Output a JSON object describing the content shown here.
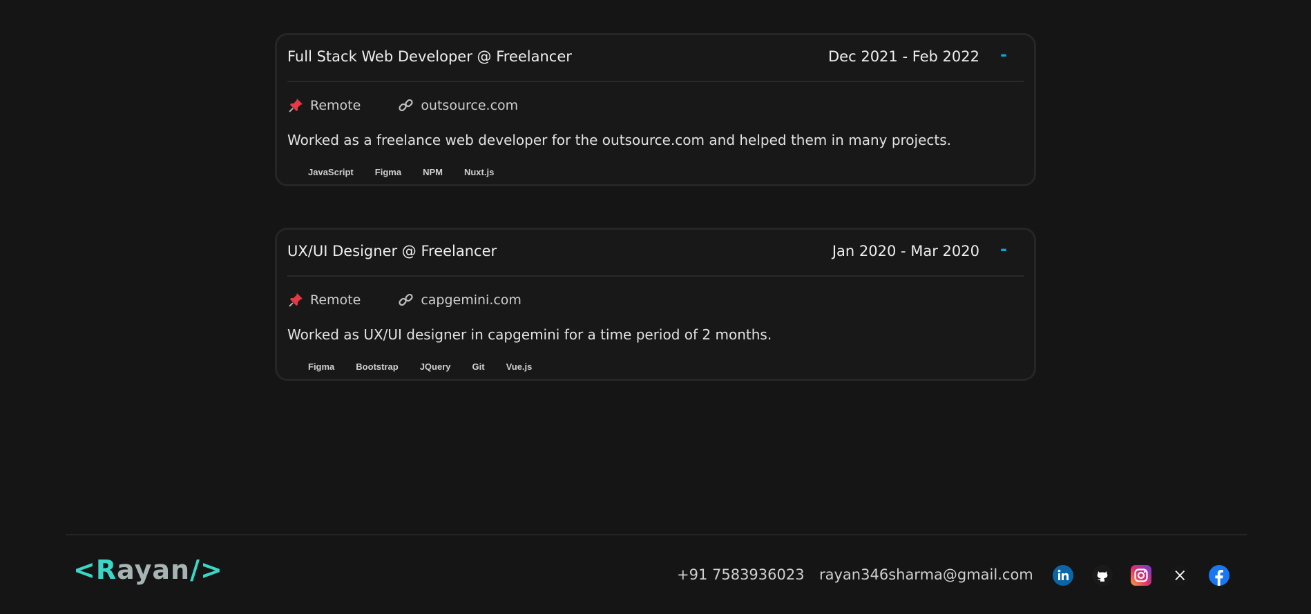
{
  "experiences": [
    {
      "title": "Full Stack Web Developer @ Freelancer",
      "date": "Dec 2021 - Feb 2022",
      "toggle": "-",
      "location": "Remote",
      "website": "outsource.com",
      "description": "Worked as a freelance web developer for the outsource.com and helped them in many projects.",
      "tags": [
        "JavaScript",
        "Figma",
        "NPM",
        "Nuxt.js"
      ]
    },
    {
      "title": "UX/UI Designer @ Freelancer",
      "date": "Jan 2020 - Mar 2020",
      "toggle": "-",
      "location": "Remote",
      "website": "capgemini.com",
      "description": "Worked as UX/UI designer in capgemini for a time period of 2 months.",
      "tags": [
        "Figma",
        "Bootstrap",
        "JQuery",
        "Git",
        "Vue.js"
      ]
    }
  ],
  "footer": {
    "logo_open": "<",
    "logo_first": "R",
    "logo_rest": "ayan",
    "logo_close": "/>",
    "phone": "+91 7583936023",
    "email": "rayan346sharma@gmail.com",
    "socials": [
      "linkedin-icon",
      "github-icon",
      "instagram-icon",
      "x-icon",
      "facebook-icon"
    ]
  },
  "colors": {
    "background": "#151515",
    "card_background": "#181818",
    "accent": "#0ea5d9",
    "logo": "#3bd6c6"
  }
}
